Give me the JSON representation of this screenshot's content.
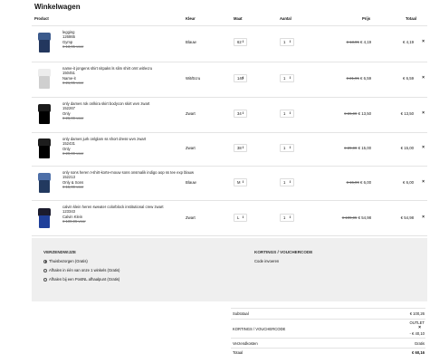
{
  "page": {
    "title": "Winkelwagen"
  },
  "table": {
    "headers": {
      "product": "Product",
      "colour": "Kleur",
      "size": "Maat",
      "qty": "Aantal",
      "price": "Prijs",
      "total": "Totaal"
    }
  },
  "items": [
    {
      "name": "legging",
      "code": "126865",
      "brand": "Gymp",
      "was": "€ 13,95 voor",
      "colour": "Blauw",
      "size": "62",
      "qty": "1",
      "price_old": "€ 13,95",
      "price_new": "€ 4,19",
      "total": "€ 4,19",
      "img_colors": [
        "#3b5a8c",
        "#23375e"
      ]
    },
    {
      "name": "name-it jongens shirt nitpaks ls slim shirt ornt wit/ecru",
      "code": "150451",
      "brand": "Name-it",
      "was": "€ 21,95 voor",
      "colour": "Wit/Ecru",
      "size": "140",
      "qty": "1",
      "price_old": "€ 21,95",
      "price_new": "€ 6,59",
      "total": "€ 6,59",
      "img_colors": [
        "#ececec",
        "#cfcfcf"
      ]
    },
    {
      "name": "only dames rok onlkira skirt bodycon skirt wvn zwart",
      "code": "152267",
      "brand": "Only",
      "was": "€ 26,99 voor",
      "colour": "Zwart",
      "size": "34",
      "qty": "1",
      "price_old": "€ 26,99",
      "price_new": "€ 13,50",
      "total": "€ 13,50",
      "img_colors": [
        "#1a1a1a",
        "#000000"
      ]
    },
    {
      "name": "only dames jurk onlglam ss short dress wvn zwart",
      "code": "152431",
      "brand": "Only",
      "was": "€ 29,99 voor",
      "colour": "Zwart",
      "size": "38",
      "qty": "1",
      "price_old": "€ 29,99",
      "price_new": "€ 15,00",
      "total": "€ 15,00",
      "img_colors": [
        "#1d1d1d",
        "#000000"
      ]
    },
    {
      "name": "only sons heren t-shirt-korte-mouw sons onsmalik indigo aop ss tee exp blauw",
      "code": "152213",
      "brand": "Only & Sons",
      "was": "€ 15,99 voor",
      "colour": "Blauw",
      "size": "M",
      "qty": "1",
      "price_old": "€ 15,99",
      "price_new": "€ 6,00",
      "total": "€ 6,00",
      "img_colors": [
        "#4d6fa8",
        "#22395f"
      ]
    },
    {
      "name": "calvin klein heren sweater colorblock institutional crew zwart",
      "code": "123343",
      "brand": "Calvin Klein",
      "was": "€ 109,95 voor",
      "colour": "Zwart",
      "size": "L",
      "qty": "1",
      "price_old": "€ 109,95",
      "price_new": "€ 54,98",
      "total": "€ 54,98",
      "img_colors": [
        "#1b1b2e",
        "#1f3f9a"
      ]
    }
  ],
  "shipping": {
    "heading": "VERZENDWIJZE",
    "options": [
      {
        "label": "Thuisbezorgen (Gratis)",
        "selected": true
      },
      {
        "label": "Afhalen in één van onze 1 winkels (Gratis)",
        "selected": false
      },
      {
        "label": "Afhalen bij een PostNL afhaalpunt (Gratis)",
        "selected": false
      }
    ]
  },
  "coupons": {
    "heading": "KORTINGS / VOUCHERCODE",
    "link": "Code invoeren"
  },
  "summary": {
    "subtotal_label": "Subtotaal",
    "subtotal": "€ 100,26",
    "voucher_label": "KORTINGS / VOUCHERCODE",
    "voucher_code": "OUTLET",
    "voucher_remove": "×",
    "voucher_amount": "- € 40,10",
    "shipping_label": "Verzendkosten",
    "shipping": "Gratis",
    "total_label": "Totaal",
    "total": "€ 60,16"
  },
  "icons": {
    "remove": "×",
    "dropdown": "⇕"
  }
}
